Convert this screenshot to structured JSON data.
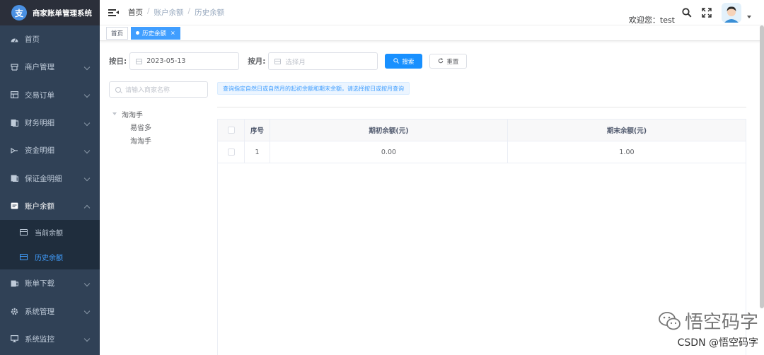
{
  "app": {
    "title": "商家账单管理系统",
    "logo_char": "支"
  },
  "sidebar": {
    "items": [
      {
        "label": "首页",
        "icon": "dashboard-icon"
      },
      {
        "label": "商户管理",
        "icon": "merchant-icon"
      },
      {
        "label": "交易订单",
        "icon": "order-icon"
      },
      {
        "label": "财务明细",
        "icon": "finance-icon"
      },
      {
        "label": "资金明细",
        "icon": "funds-icon"
      },
      {
        "label": "保证金明细",
        "icon": "deposit-icon"
      },
      {
        "label": "账户余额",
        "icon": "balance-icon",
        "open": true
      },
      {
        "label": "账单下载",
        "icon": "download-icon"
      },
      {
        "label": "系统管理",
        "icon": "settings-icon"
      },
      {
        "label": "系统监控",
        "icon": "monitor-icon"
      }
    ],
    "submenu": [
      {
        "label": "当前余额"
      },
      {
        "label": "历史余额",
        "active": true
      }
    ]
  },
  "header": {
    "breadcrumb": {
      "home": "首页",
      "sep": "/",
      "mid": "账户余额",
      "current": "历史余额"
    },
    "welcome": "欢迎您：test"
  },
  "tags": {
    "home": "首页",
    "active": "历史余额",
    "close": "×"
  },
  "form": {
    "day_label": "按日:",
    "day_value": "2023-05-13",
    "month_label": "按月:",
    "month_placeholder": "选择月",
    "search_button": "搜索",
    "reset_button": "重置"
  },
  "tree": {
    "search_placeholder": "请输入商家名称",
    "root": "淘淘手",
    "children": [
      "易省多",
      "淘淘手"
    ]
  },
  "notice": "查询指定自然日或自然月的起初余额和期末余额，请选择按日或按月查询",
  "table": {
    "headers": {
      "no": "序号",
      "open": "期初余额(元)",
      "close": "期末余额(元)"
    },
    "rows": [
      {
        "no": "1",
        "open": "0.00",
        "close": "1.00"
      }
    ]
  },
  "watermark": {
    "top": "悟空码字",
    "bottom": "CSDN @悟空码字"
  },
  "colors": {
    "sidebar_bg": "#304156",
    "accent": "#409eff",
    "primary_button": "#1890ff"
  }
}
